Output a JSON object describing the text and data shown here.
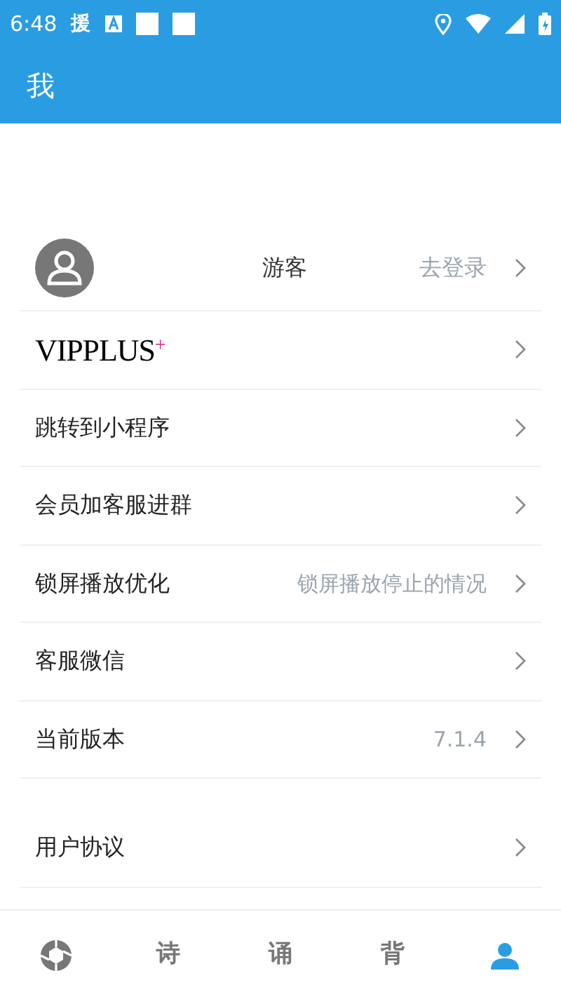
{
  "status_bar": {
    "time": "6:48",
    "notification": "援"
  },
  "header": {
    "title": "我"
  },
  "profile": {
    "name": "游客",
    "action": "去登录"
  },
  "menu": [
    {
      "kind": "brand",
      "label": "VIPPLUS$^{+}$"
    },
    {
      "kind": "item",
      "label": "跳转到小程序"
    },
    {
      "kind": "item",
      "label": "会员加客服进群"
    },
    {
      "kind": "item",
      "label": "锁屏播放优化",
      "value": "锁屏播放停止的情况"
    },
    {
      "kind": "item",
      "label": "客服微信"
    },
    {
      "kind": "item",
      "label": "当前版本",
      "value": "7.1.4"
    }
  ],
  "menu_2": [
    {
      "kind": "item",
      "label": "用户协议"
    }
  ],
  "tabs": [
    {
      "kind": "icon",
      "selected": false
    },
    {
      "kind": "text",
      "label": "诗",
      "selected": false
    },
    {
      "kind": "text",
      "label": "诵",
      "selected": false
    },
    {
      "kind": "text",
      "label": "背",
      "selected": false
    },
    {
      "kind": "icon-person",
      "selected": true
    }
  ]
}
